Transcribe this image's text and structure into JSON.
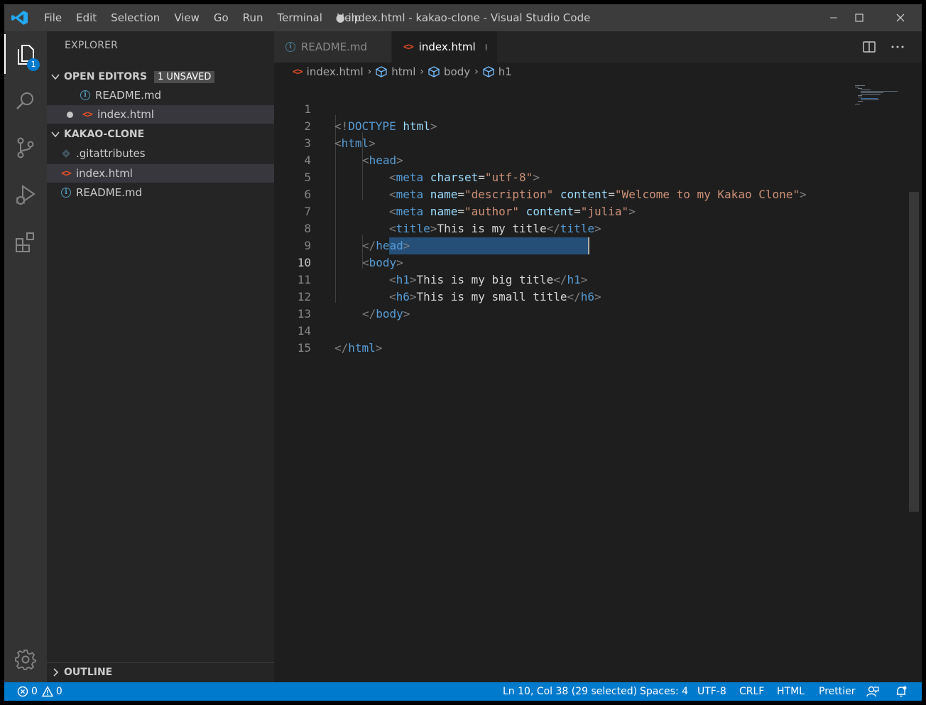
{
  "titlebar": {
    "menu": [
      "File",
      "Edit",
      "Selection",
      "View",
      "Go",
      "Run",
      "Terminal",
      "Help"
    ],
    "title": "● index.html - kakao-clone - Visual Studio Code"
  },
  "activitybar": {
    "items": [
      "explorer-icon",
      "search-icon",
      "source-control-icon",
      "run-debug-icon",
      "extensions-icon"
    ],
    "explorer_badge": "1",
    "bottom": "gear-icon"
  },
  "sidebar": {
    "title": "EXPLORER",
    "open_editors": {
      "label": "OPEN EDITORS",
      "badge": "1 UNSAVED",
      "items": [
        "README.md",
        "index.html"
      ]
    },
    "project": {
      "label": "KAKAO-CLONE",
      "items": [
        ".gitattributes",
        "index.html",
        "README.md"
      ]
    },
    "outline_label": "OUTLINE"
  },
  "tabs": [
    {
      "label": "README.md",
      "active": false
    },
    {
      "label": "index.html",
      "active": true,
      "unsaved": true
    }
  ],
  "breadcrumb": [
    "index.html",
    "html",
    "body",
    "h1"
  ],
  "editor": {
    "line_numbers": [
      "1",
      "2",
      "3",
      "4",
      "5",
      "6",
      "7",
      "8",
      "9",
      "10",
      "11",
      "12",
      "13",
      "14",
      "15"
    ],
    "lines": {
      "l1": {
        "a": "<!",
        "b": "DOCTYPE",
        "c": " html",
        "d": ">"
      },
      "l2": {
        "a": "<",
        "b": "html",
        "c": ">"
      },
      "l3": {
        "a": "<",
        "b": "head",
        "c": ">"
      },
      "l4": {
        "a": "<",
        "b": "meta",
        "c": " charset",
        "d": "=",
        "e": "\"utf-8\"",
        "f": ">"
      },
      "l5": {
        "a": "<",
        "b": "meta",
        "c": " name",
        "d": "=",
        "e": "\"description\"",
        "f": " content",
        "g": "=",
        "h": "\"Welcome to my Kakao Clone\"",
        "i": ">"
      },
      "l6": {
        "a": "<",
        "b": "meta",
        "c": " name",
        "d": "=",
        "e": "\"author\"",
        "f": " content",
        "g": "=",
        "h": "\"julia\"",
        "i": ">"
      },
      "l7": {
        "a": "<",
        "b": "title",
        "c": ">",
        "d": "This is my title",
        "e": "</",
        "f": "title",
        "g": ">"
      },
      "l8": {
        "a": "</",
        "b": "head",
        "c": ">"
      },
      "l9": {
        "a": "<",
        "b": "body",
        "c": ">"
      },
      "l10": {
        "a": "<",
        "b": "h1",
        "c": ">",
        "d": "This is my big title",
        "e": "</",
        "f": "h1",
        "g": ">"
      },
      "l11": {
        "a": "<",
        "b": "h6",
        "c": ">",
        "d": "This is my small title",
        "e": "</",
        "f": "h6",
        "g": ">"
      },
      "l12": {
        "a": "</",
        "b": "body",
        "c": ">"
      },
      "l14": {
        "a": "</",
        "b": "html",
        "c": ">"
      }
    }
  },
  "statusbar": {
    "errors": "0",
    "warnings": "0",
    "position": "Ln 10, Col 38 (29 selected)",
    "spaces": "Spaces: 4",
    "encoding": "UTF-8",
    "eol": "CRLF",
    "language": "HTML",
    "formatter": "Prettier"
  },
  "colors": {
    "statusbar": "#007acc",
    "tag": "#569cd6",
    "attribute": "#9cdcfe",
    "string": "#ce9178",
    "html_icon": "#e44d26",
    "info_icon": "#519aba"
  }
}
